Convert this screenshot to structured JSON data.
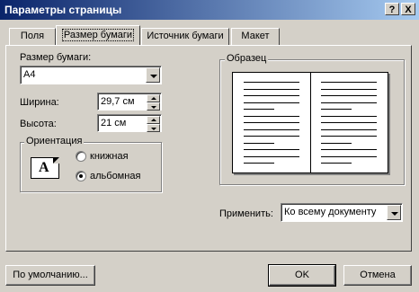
{
  "window": {
    "title": "Параметры страницы",
    "help_glyph": "?",
    "close_glyph": "X"
  },
  "tabs": [
    {
      "label": "Поля",
      "active": false
    },
    {
      "label": "Размер бумаги",
      "active": true
    },
    {
      "label": "Источник бумаги",
      "active": false
    },
    {
      "label": "Макет",
      "active": false
    }
  ],
  "paper": {
    "size_label": "Размер бумаги:",
    "size_value": "A4",
    "width_label": "Ширина:",
    "width_value": "29,7 см",
    "height_label": "Высота:",
    "height_value": "21 см"
  },
  "orientation": {
    "group_label": "Ориентация",
    "icon_letter": "A",
    "portrait_label": "книжная",
    "landscape_label": "альбомная",
    "selected": "landscape"
  },
  "preview": {
    "group_label": "Образец"
  },
  "apply": {
    "label": "Применить:",
    "value": "Ко всему документу"
  },
  "buttons": {
    "default_label": "По умолчанию...",
    "ok_label": "OK",
    "cancel_label": "Отмена"
  },
  "colors": {
    "face": "#d4d0c8",
    "title_start": "#0a246a",
    "title_end": "#a6caf0"
  }
}
